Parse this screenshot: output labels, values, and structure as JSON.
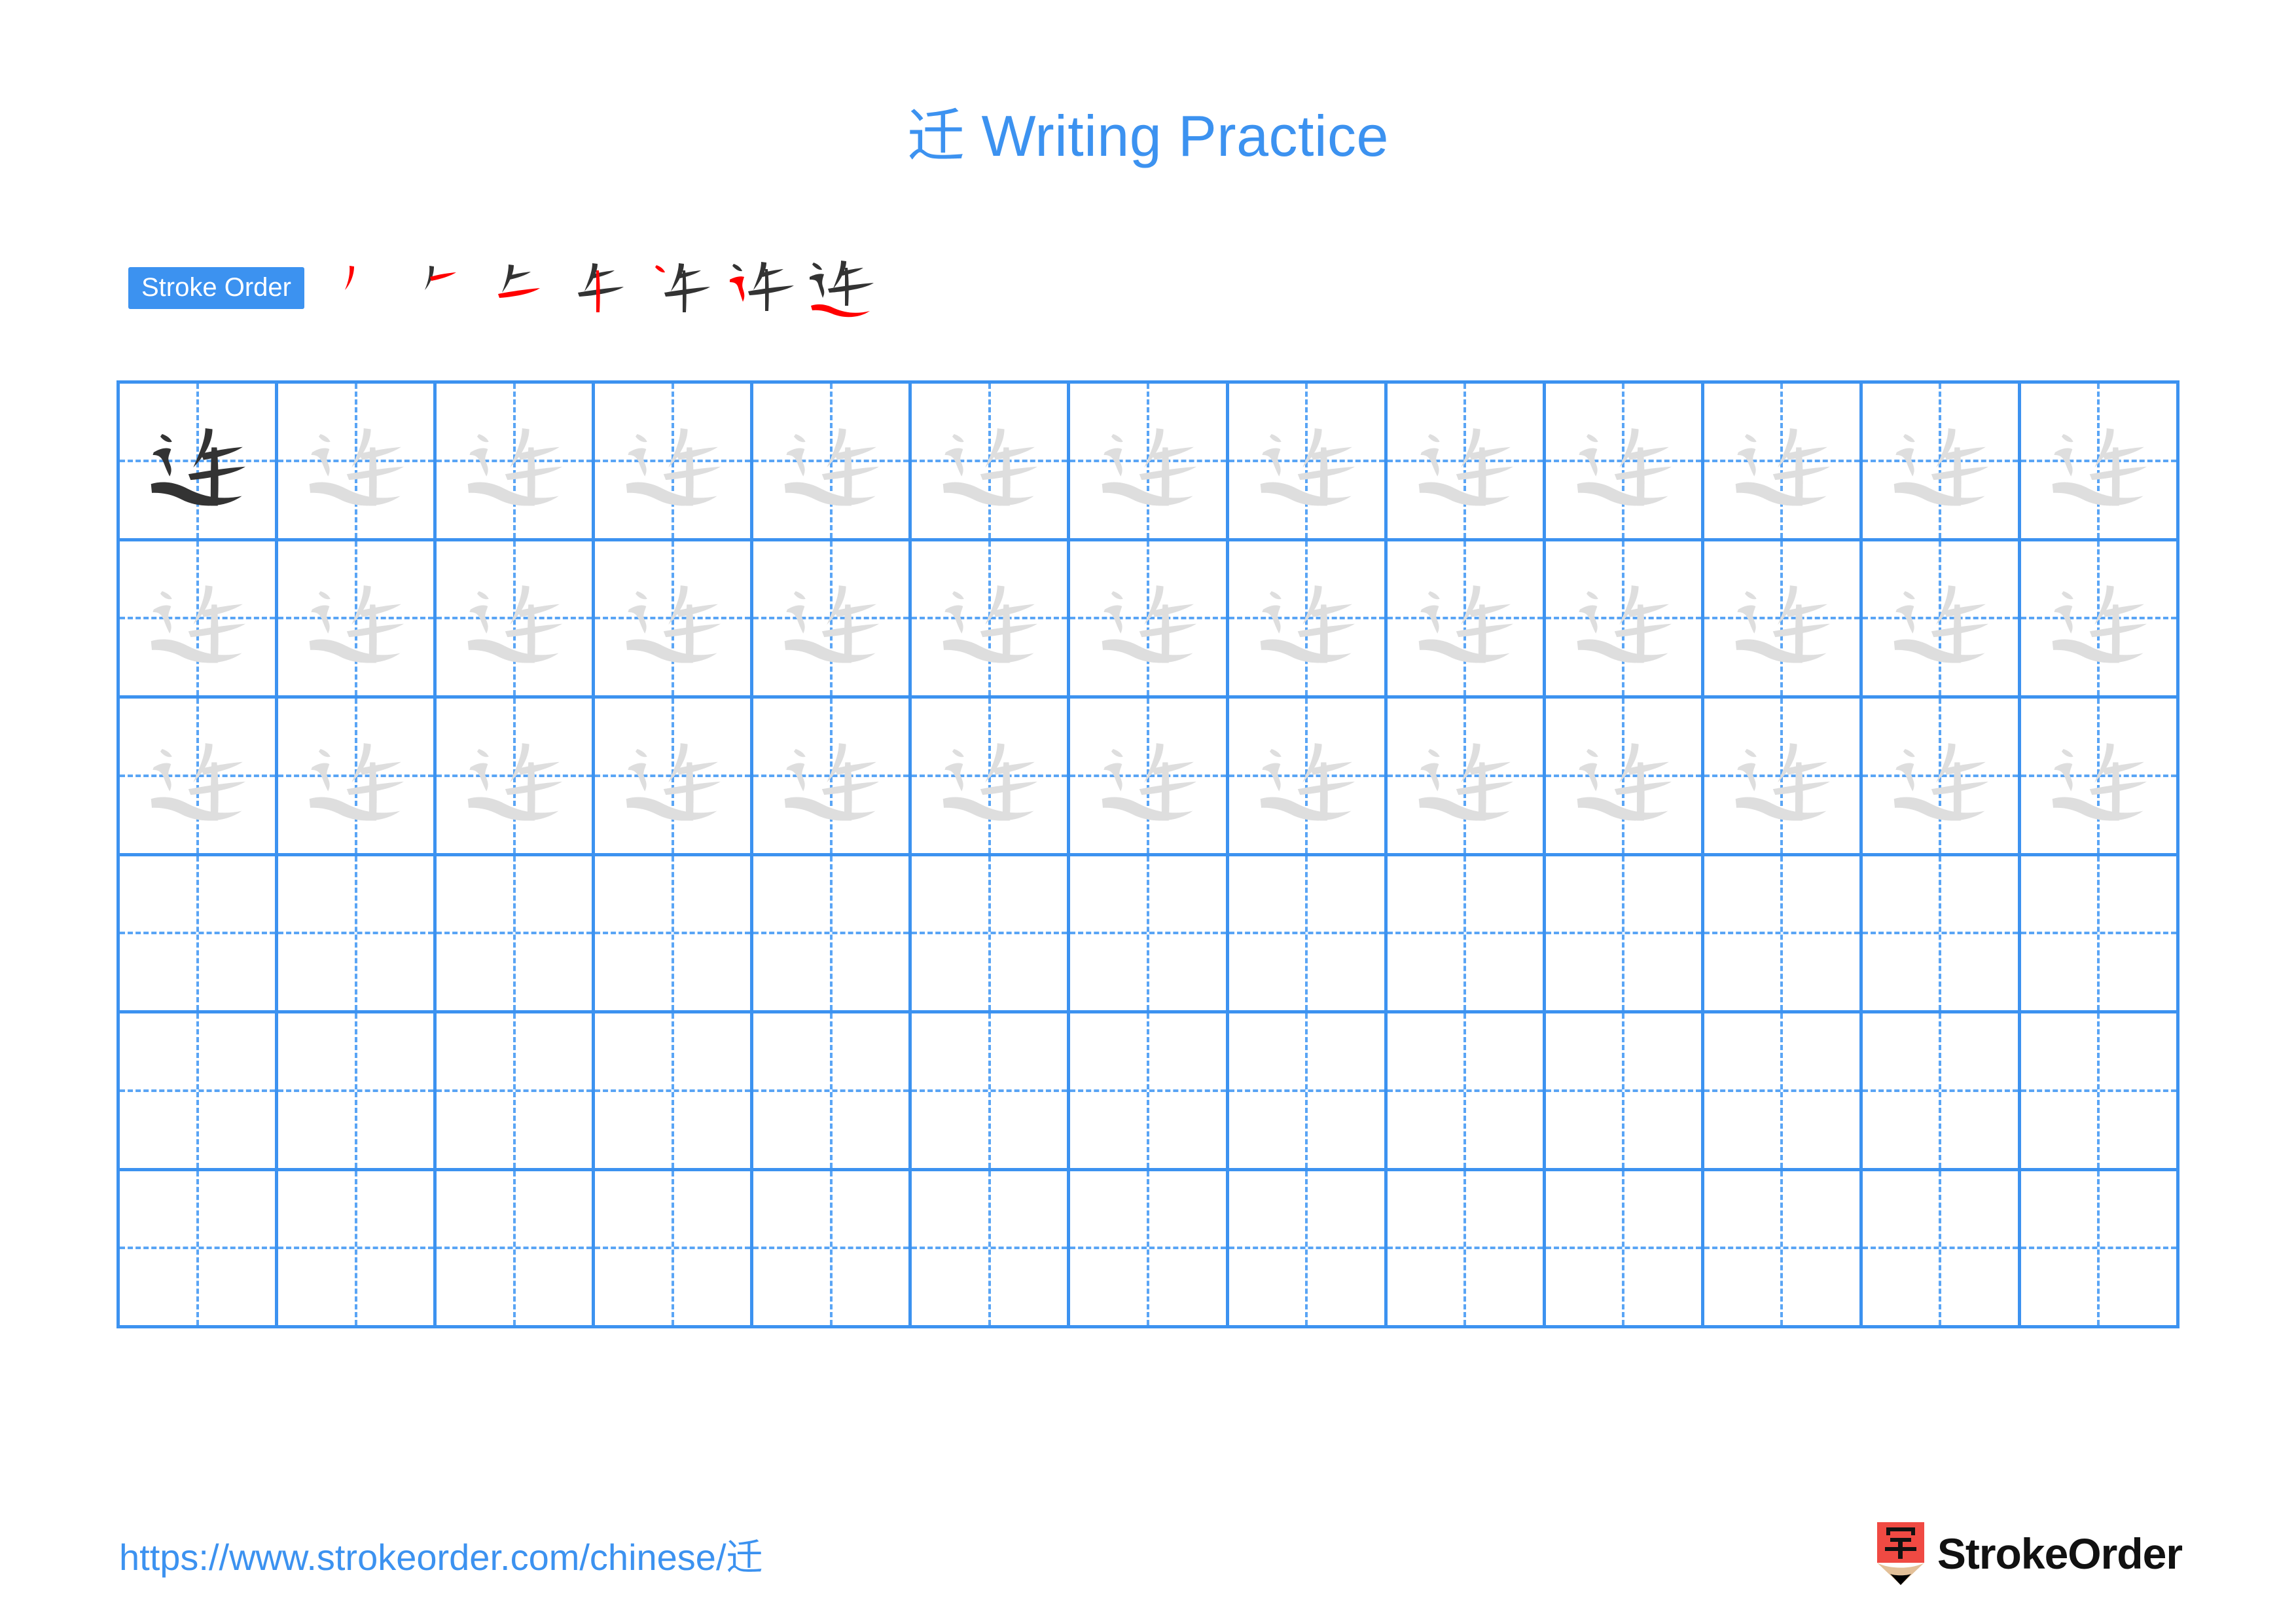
{
  "page": {
    "character": "迁",
    "title_suffix": " Writing Practice",
    "accent_color": "#3C92F0",
    "grid_line_color": "#3C92F0",
    "guide_line_color": "#5AA5F5",
    "example_ink_color": "#333333",
    "trace_ink_color": "#DEDEDE",
    "new_stroke_color": "#FF0000",
    "done_stroke_color": "#333333"
  },
  "stroke_order": {
    "badge_label": "Stroke Order",
    "total_strokes": 7,
    "steps": [
      {
        "index": 1,
        "name": "pie-left-falling"
      },
      {
        "index": 2,
        "name": "heng-short-horizontal"
      },
      {
        "index": 3,
        "name": "heng-horizontal"
      },
      {
        "index": 4,
        "name": "shu-vertical"
      },
      {
        "index": 5,
        "name": "dian-dot"
      },
      {
        "index": 6,
        "name": "hengzhezhe-walking-radical-curve"
      },
      {
        "index": 7,
        "name": "pingna-sweeping-base"
      }
    ]
  },
  "practice_grid": {
    "columns": 13,
    "rows": 6,
    "rows_data": [
      {
        "row": 1,
        "cells": [
          "example",
          "trace",
          "trace",
          "trace",
          "trace",
          "trace",
          "trace",
          "trace",
          "trace",
          "trace",
          "trace",
          "trace",
          "trace"
        ]
      },
      {
        "row": 2,
        "cells": [
          "trace",
          "trace",
          "trace",
          "trace",
          "trace",
          "trace",
          "trace",
          "trace",
          "trace",
          "trace",
          "trace",
          "trace",
          "trace"
        ]
      },
      {
        "row": 3,
        "cells": [
          "trace",
          "trace",
          "trace",
          "trace",
          "trace",
          "trace",
          "trace",
          "trace",
          "trace",
          "trace",
          "trace",
          "trace",
          "trace"
        ]
      },
      {
        "row": 4,
        "cells": [
          "empty",
          "empty",
          "empty",
          "empty",
          "empty",
          "empty",
          "empty",
          "empty",
          "empty",
          "empty",
          "empty",
          "empty",
          "empty"
        ]
      },
      {
        "row": 5,
        "cells": [
          "empty",
          "empty",
          "empty",
          "empty",
          "empty",
          "empty",
          "empty",
          "empty",
          "empty",
          "empty",
          "empty",
          "empty",
          "empty"
        ]
      },
      {
        "row": 6,
        "cells": [
          "empty",
          "empty",
          "empty",
          "empty",
          "empty",
          "empty",
          "empty",
          "empty",
          "empty",
          "empty",
          "empty",
          "empty",
          "empty"
        ]
      }
    ]
  },
  "footer": {
    "url_prefix": "https://www.strokeorder.com/chinese/",
    "url_char": "迁",
    "brand_name": "StrokeOrder",
    "brand_mark_char": "字",
    "brand_mark_body_color": "#F04A43",
    "brand_mark_wood_color": "#E3C098",
    "brand_mark_tip_color": "#000000"
  }
}
